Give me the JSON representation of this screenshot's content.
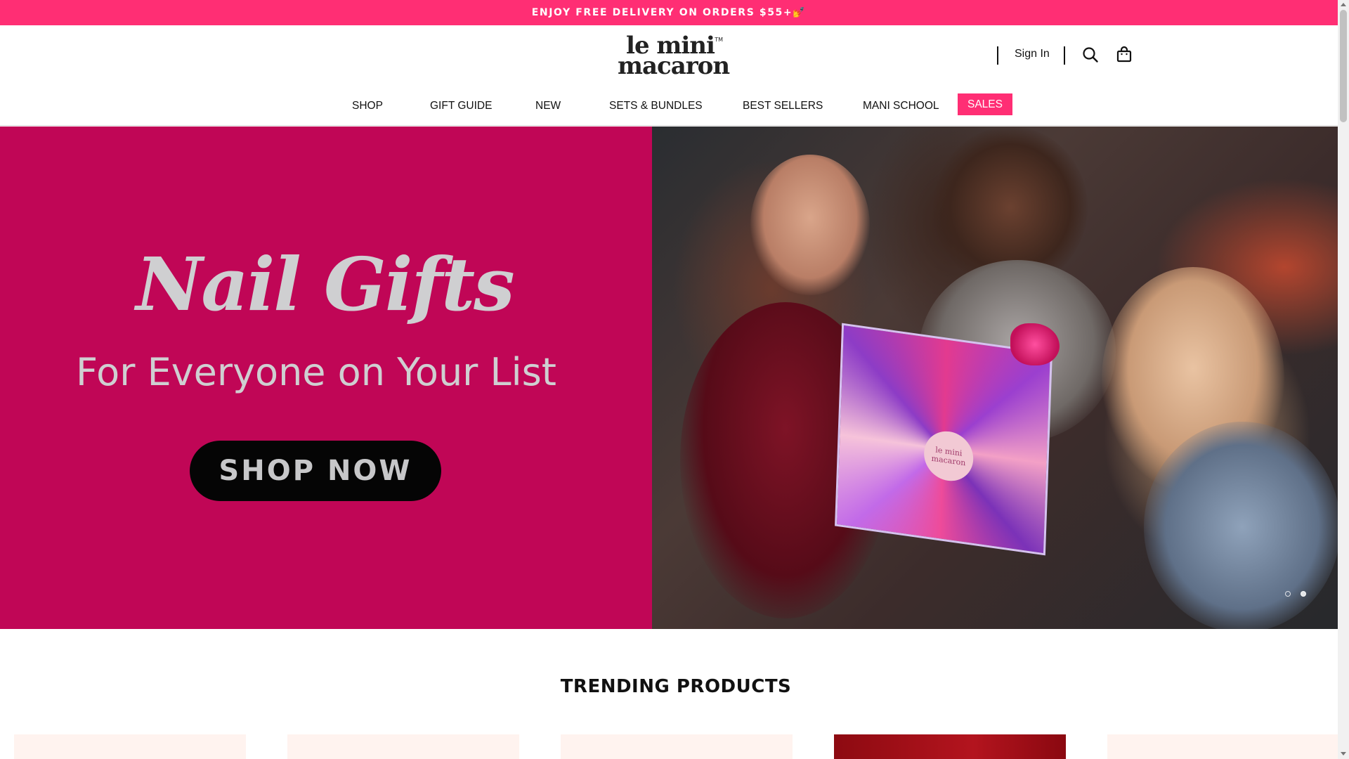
{
  "promo": {
    "text": "ENJOY FREE DELIVERY ON ORDERS $55+💅"
  },
  "logo": {
    "line1": "le mini",
    "line2": "macaron",
    "tm": "TM"
  },
  "header": {
    "sign_in": "Sign In",
    "search_icon": "search-icon",
    "cart_icon": "shopping-bag-icon"
  },
  "nav": {
    "items": [
      {
        "label": "SHOP"
      },
      {
        "label": "GIFT GUIDE"
      },
      {
        "label": "NEW"
      },
      {
        "label": "SETS & BUNDLES"
      },
      {
        "label": "BEST SELLERS"
      },
      {
        "label": "MANI SCHOOL"
      },
      {
        "label": "SALES"
      }
    ]
  },
  "hero": {
    "title": "Nail Gifts",
    "subtitle": "For Everyone on Your List",
    "cta": "SHOP NOW",
    "gift_label": "le mini macaron",
    "slides": 2,
    "active_slide": 2
  },
  "trending": {
    "title": "TRENDING PRODUCTS",
    "products": [
      {
        "name": "product-1"
      },
      {
        "name": "product-2"
      },
      {
        "name": "product-3"
      },
      {
        "name": "product-4"
      },
      {
        "name": "product-5"
      }
    ]
  },
  "colors": {
    "brand_pink": "#ff2e74",
    "hero_magenta": "#c00656",
    "cta_black": "#050505"
  }
}
